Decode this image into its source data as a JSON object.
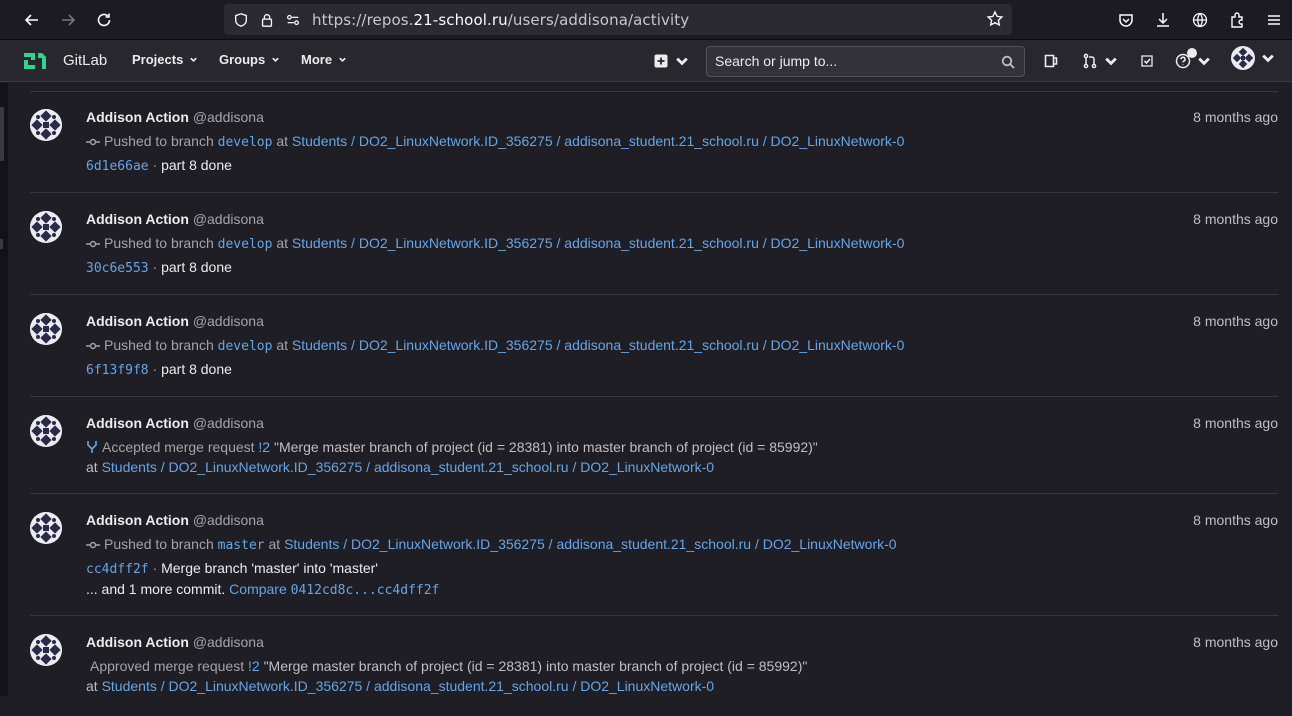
{
  "browser": {
    "url_prefix": "https://repos.",
    "url_domain": "21-school.ru",
    "url_path": "/users/addisona/activity"
  },
  "nav": {
    "brand": "GitLab",
    "projects": "Projects",
    "groups": "Groups",
    "more": "More",
    "search_placeholder": "Search or jump to..."
  },
  "events": [
    {
      "name": "Addison Action",
      "user": "@addisona",
      "time": "8 months ago",
      "action": "Pushed to branch",
      "branch": "develop",
      "at": "at",
      "project": "Students / DO2_LinuxNetwork.ID_356275 / addisona_student.21_school.ru / DO2_LinuxNetwork-0",
      "sha": "6d1e66ae",
      "sep": "·",
      "message": "part 8 done"
    },
    {
      "name": "Addison Action",
      "user": "@addisona",
      "time": "8 months ago",
      "action": "Pushed to branch",
      "branch": "develop",
      "at": "at",
      "project": "Students / DO2_LinuxNetwork.ID_356275 / addisona_student.21_school.ru / DO2_LinuxNetwork-0",
      "sha": "30c6e553",
      "sep": "·",
      "message": "part 8 done"
    },
    {
      "name": "Addison Action",
      "user": "@addisona",
      "time": "8 months ago",
      "action": "Pushed to branch",
      "branch": "develop",
      "at": "at",
      "project": "Students / DO2_LinuxNetwork.ID_356275 / addisona_student.21_school.ru / DO2_LinuxNetwork-0",
      "sha": "6f13f9f8",
      "sep": "·",
      "message": "part 8 done"
    },
    {
      "name": "Addison Action",
      "user": "@addisona",
      "time": "8 months ago",
      "action": "Accepted merge request",
      "mr": "!2",
      "mr_title": "\"Merge master branch of project (id = 28381) into master branch of project (id = 85992)\"",
      "at": "at",
      "project": "Students / DO2_LinuxNetwork.ID_356275 / addisona_student.21_school.ru / DO2_LinuxNetwork-0"
    },
    {
      "name": "Addison Action",
      "user": "@addisona",
      "time": "8 months ago",
      "action": "Pushed to branch",
      "branch": "master",
      "at": "at",
      "project": "Students / DO2_LinuxNetwork.ID_356275 / addisona_student.21_school.ru / DO2_LinuxNetwork-0",
      "sha": "cc4dff2f",
      "sep": "·",
      "message": "Merge branch 'master' into 'master'",
      "more": "... and 1 more commit.",
      "compare": "Compare",
      "compare_range": "0412cd8c...cc4dff2f"
    },
    {
      "name": "Addison Action",
      "user": "@addisona",
      "time": "8 months ago",
      "action": "Approved merge request",
      "mr": "!2",
      "mr_title": "\"Merge master branch of project (id = 28381) into master branch of project (id = 85992)\"",
      "at": "at",
      "project": "Students / DO2_LinuxNetwork.ID_356275 / addisona_student.21_school.ru / DO2_LinuxNetwork-0"
    }
  ]
}
